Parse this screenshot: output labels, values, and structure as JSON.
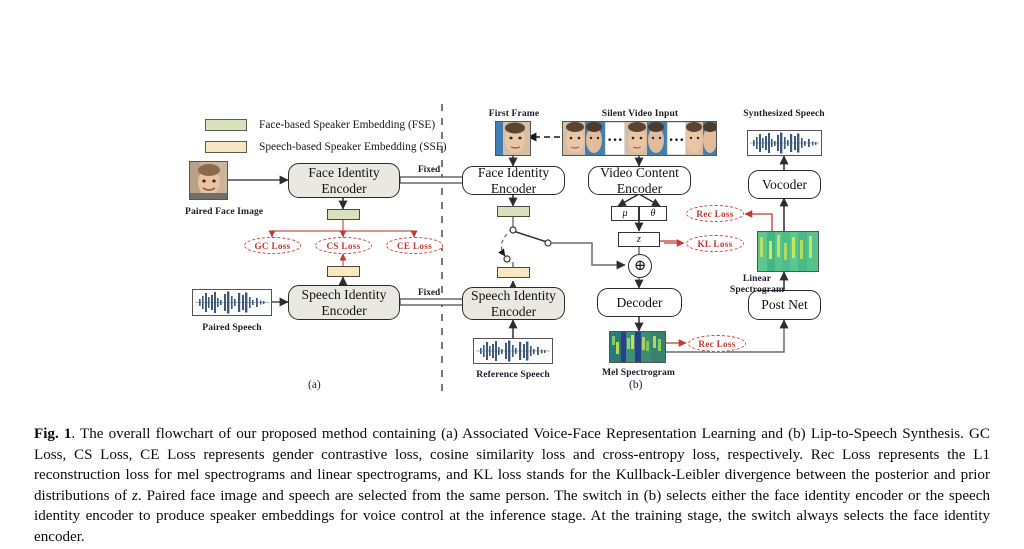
{
  "figure": {
    "legend": [
      {
        "label": "Face-based Speaker Embedding (FSE)",
        "color": "#d7e2bd"
      },
      {
        "label": "Speech-based Speaker Embedding (SSE)",
        "color": "#f7e8c2"
      }
    ],
    "panel_a": {
      "tag": "(a)",
      "face_image_caption": "Paired Face Image",
      "speech_caption": "Paired Speech",
      "face_encoder": "Face Identity\nEncoder",
      "speech_encoder": "Speech Identity\nEncoder",
      "fixed_label_top": "Fixed",
      "fixed_label_bottom": "Fixed",
      "losses": [
        "GC Loss",
        "CS Loss",
        "CE Loss"
      ]
    },
    "panel_b": {
      "tag": "(b)",
      "first_frame_caption": "First Frame",
      "silent_video_caption": "Silent Video Input",
      "synthesized_caption": "Synthesized Speech",
      "reference_speech_caption": "Reference Speech",
      "mel_caption": "Mel Spectrogram",
      "linear_caption": "Linear\nSpectrogram",
      "linear_caption_l1": "Linear",
      "linear_caption_l2": "Spectrogram",
      "face_encoder": "Face Identity\nEncoder",
      "speech_encoder": "Speech Identity\nEncoder",
      "video_encoder": "Video Content\nEncoder",
      "decoder": "Decoder",
      "post_net": "Post Net",
      "vocoder": "Vocoder",
      "mu_label": "μ",
      "theta_label": "θ",
      "z_label": "z",
      "plus_label": "⊕",
      "losses": {
        "rec_loss_top": "Rec Loss",
        "kl_loss": "KL Loss",
        "rec_loss_mel": "Rec Loss"
      },
      "ellipsis": "•••"
    },
    "colors": {
      "fse_green": "#d7e2bd",
      "sse_cream": "#f7e8c2",
      "loss_red": "#c03a32",
      "box_shade": "#e9e9e2",
      "arrow_gray": "#4a4a4a",
      "spec_green": "#5cb85c"
    }
  },
  "caption": {
    "figure_number": "Fig. 1",
    "text_1": ". The overall flowchart of our proposed method containing (a) Associated Voice-Face Representation Learning and (b) Lip-to-Speech Synthesis. GC Loss, CS Loss, CE Loss represents gender contrastive loss, cosine similarity loss and cross-entropy loss, respectively. Rec Loss represents the L1 reconstruction loss for mel spectrograms and linear spectrograms, and KL loss stands for the Kullback-Leibler divergence between the posterior and prior distributions of ",
    "italic_z": "z",
    "text_2": ". Paired face image and speech are selected from the same person. The switch in (b) selects either the face identity encoder or the speech identity encoder to produce speaker embeddings for voice control at the inference stage. At the training stage, the switch always selects the face identity encoder."
  }
}
